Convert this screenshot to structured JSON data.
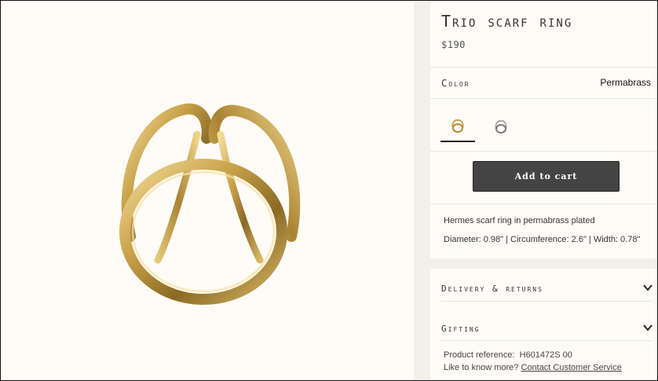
{
  "product": {
    "title": "Trio scarf ring",
    "price": "$190",
    "color_label": "Color",
    "color_value": "Permabrass",
    "swatches": [
      {
        "name": "Permabrass",
        "color": "#c9a24a",
        "selected": true
      },
      {
        "name": "Palladium",
        "color": "#9a9a9a",
        "selected": false
      }
    ],
    "add_to_cart": "Add to cart",
    "description": "Hermes scarf ring in permabrass plated",
    "dimensions": "Diameter: 0.98\" | Circumference: 2.6\" | Width: 0.78\""
  },
  "accordion": [
    {
      "label": "Delivery & returns"
    },
    {
      "label": "Gifting"
    }
  ],
  "reference": {
    "label": "Product reference:",
    "value": "H601472S 00",
    "help_text": "Like to know more?",
    "help_link": "Contact Customer Service"
  },
  "colors": {
    "gold": "#c9a24a",
    "button": "#444444",
    "background": "#fffcf7",
    "gutter": "#f3efe9"
  }
}
